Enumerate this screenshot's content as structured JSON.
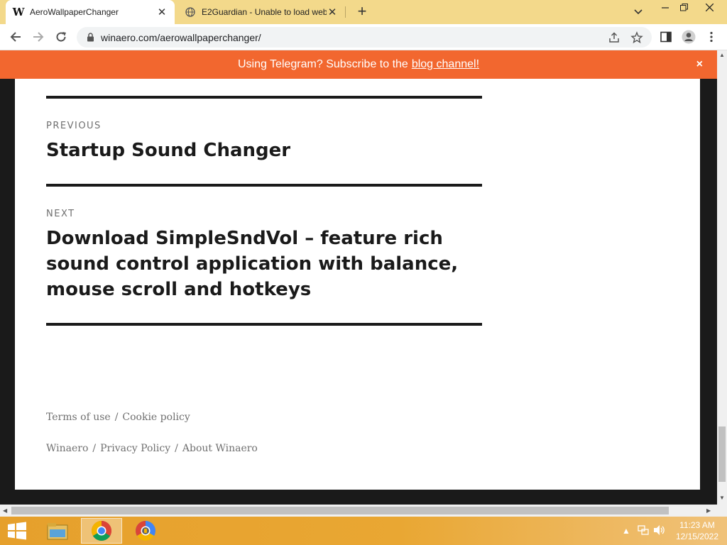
{
  "browser": {
    "tabs": [
      {
        "title": "AeroWallpaperChanger",
        "favicon": "winaero-w-icon",
        "favicon_text": "W",
        "active": true
      },
      {
        "title": "E2Guardian - Unable to load web",
        "favicon": "globe-icon",
        "active": false
      }
    ],
    "new_tab_label": "+",
    "address": "winaero.com/aerowallpaperchanger/"
  },
  "banner": {
    "text": "Using Telegram? Subscribe to the",
    "link": "blog channel!",
    "close": "×",
    "color": "#f2672f"
  },
  "post_nav": {
    "previous_label": "PREVIOUS",
    "previous_title": "Startup Sound Changer",
    "next_label": "NEXT",
    "next_title": "Download SimpleSndVol – feature rich sound control application with balance, mouse scroll and hotkeys"
  },
  "footer": {
    "row1": [
      "Terms of use",
      "Cookie policy"
    ],
    "row2": [
      "Winaero",
      "Privacy Policy",
      "About Winaero"
    ],
    "separator": "/"
  },
  "taskbar": {
    "time": "11:23 AM",
    "date": "12/15/2022",
    "accent": "#e6a02c"
  }
}
